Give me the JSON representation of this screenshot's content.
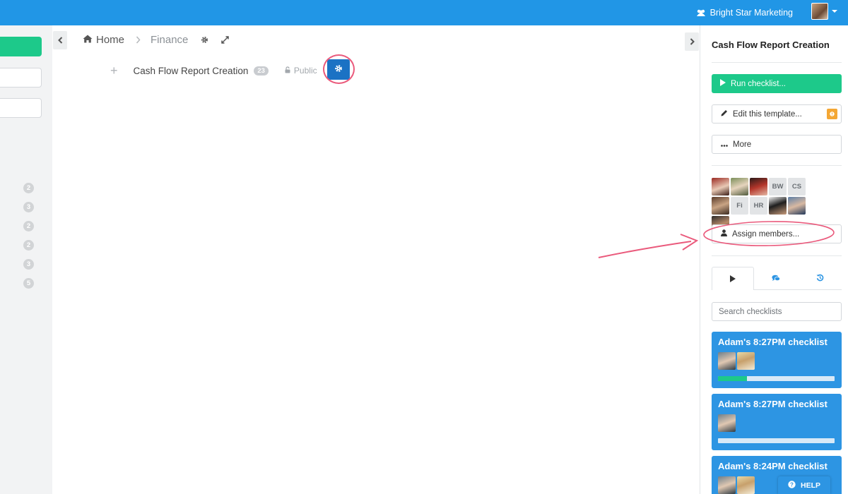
{
  "topbar": {
    "org_name": "Bright Star Marketing",
    "icons": {
      "org": "users-icon",
      "caret": "caret-down-icon"
    }
  },
  "left_sidebar": {
    "badges": [
      "2",
      "3",
      "2",
      "2",
      "3",
      "5"
    ]
  },
  "breadcrumb": {
    "home": "Home",
    "folder": "Finance",
    "icons": [
      "home-icon",
      "chevron-right-icon",
      "gear-icon",
      "expand-icon"
    ]
  },
  "template": {
    "title": "Cash Flow Report Creation",
    "count": "23",
    "visibility": "Public",
    "icons": [
      "plus-icon",
      "lock-icon",
      "gear-icon"
    ]
  },
  "right_panel": {
    "title": "Cash Flow Report Creation",
    "run_label": "Run checklist...",
    "edit_label": "Edit this template...",
    "more_label": "More",
    "assign_label": "Assign members...",
    "members": [
      "photo",
      "photo",
      "photo",
      "BW",
      "CS",
      "photo",
      "Fi",
      "HR",
      "photo",
      "photo",
      "photo"
    ],
    "tabs": [
      "play-icon",
      "comments-icon",
      "history-icon"
    ],
    "search_placeholder": "Search checklists",
    "checklists": [
      {
        "title": "Adam's 8:27PM checklist",
        "avatars": 2,
        "progress": 0.25
      },
      {
        "title": "Adam's 8:27PM checklist",
        "avatars": 1,
        "progress": 0
      },
      {
        "title": "Adam's 8:24PM checklist",
        "avatars": 2,
        "progress": 0
      }
    ]
  },
  "help": {
    "label": "HELP"
  },
  "colors": {
    "topbar": "#2196e6",
    "accent_green": "#1dc98a",
    "card_blue": "#2d95e3",
    "gear_button": "#1b72c4",
    "annotation_pink": "#ea5a7c",
    "warning": "#f4a734"
  }
}
